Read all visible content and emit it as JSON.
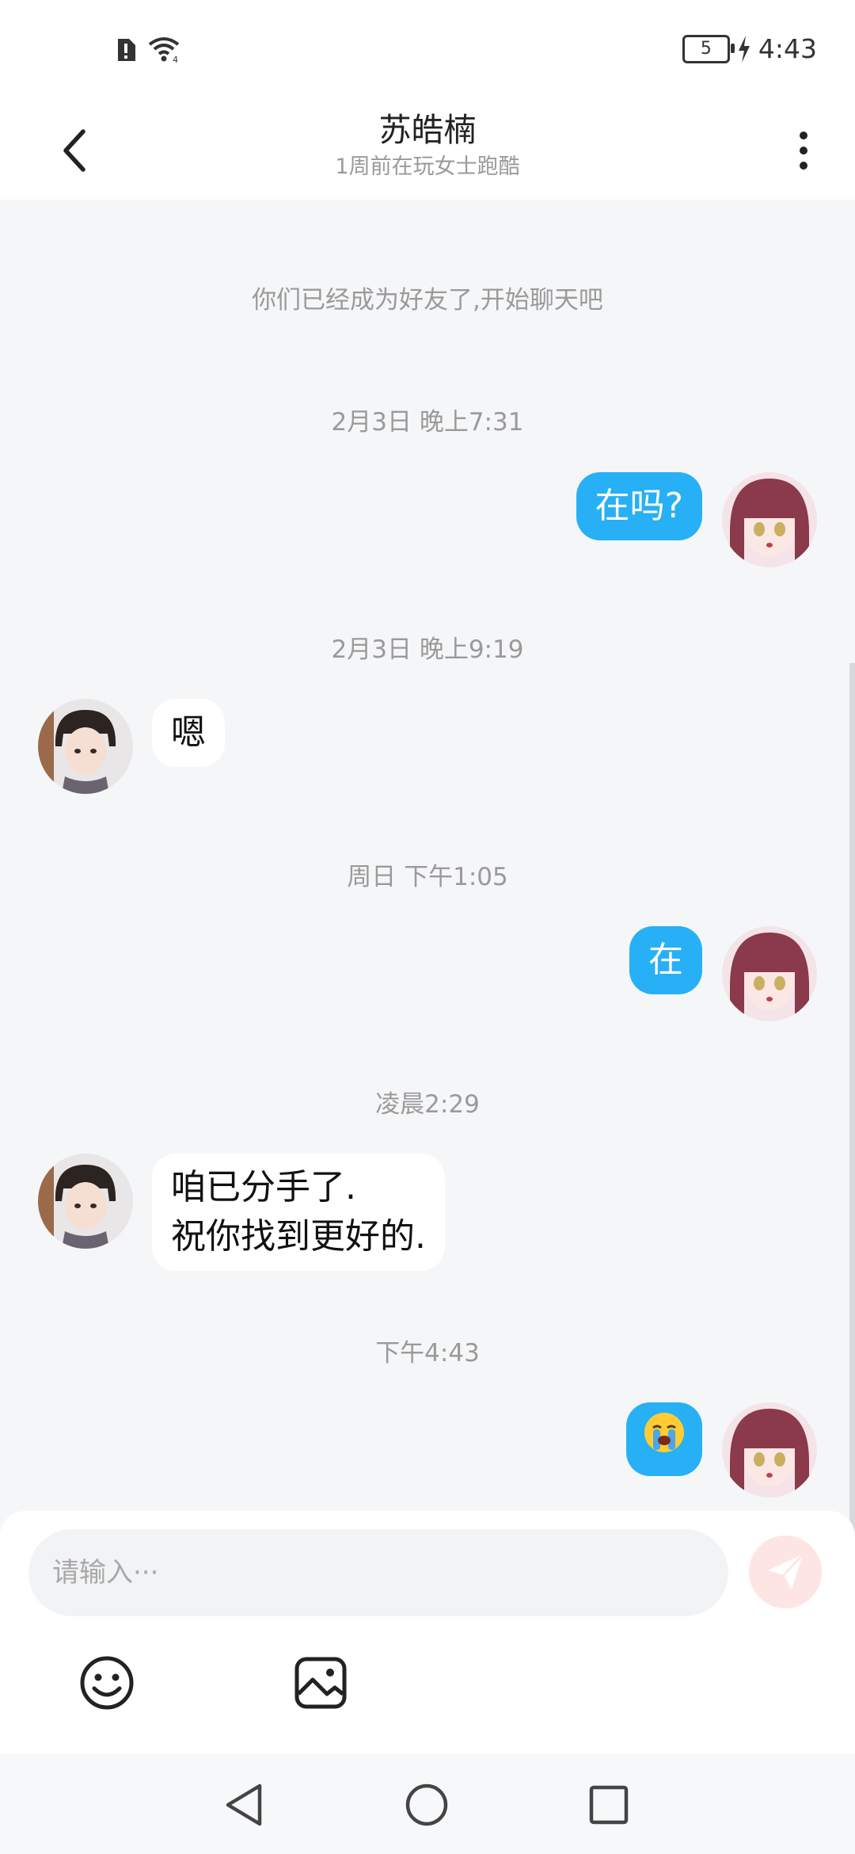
{
  "status_bar": {
    "time": "4:43",
    "battery_level": "5",
    "icons": [
      "sim-alert-icon",
      "wifi-icon",
      "battery-icon",
      "charging-icon"
    ]
  },
  "header": {
    "title": "苏皓楠",
    "subtitle": "1周前在玩女士跑酷",
    "back_icon": "chevron-left-icon",
    "more_icon": "more-vertical-icon"
  },
  "chat": {
    "system_notice": "你们已经成为好友了,开始聊天吧",
    "time_1": "2月3日 晚上7:31",
    "msg_1": "在吗?",
    "time_2": "2月3日 晚上9:19",
    "msg_2": "嗯",
    "time_3": "周日 下午1:05",
    "msg_3": "在",
    "time_4": "凌晨2:29",
    "msg_4_line1": "咱已分手了.",
    "msg_4_line2": "祝你找到更好的.",
    "time_5": "下午4:43",
    "msg_5": "😭"
  },
  "input_bar": {
    "placeholder": "请输入···",
    "value": "",
    "send_icon": "paper-plane-icon",
    "emoji_icon": "smiley-icon",
    "image_icon": "image-icon"
  },
  "nav_bar": {
    "back": "triangle-back-icon",
    "home": "circle-home-icon",
    "recents": "square-recents-icon"
  },
  "colors": {
    "accent": "#27b0f5",
    "background": "#f5f6f8",
    "send_button": "#fde5e4"
  }
}
